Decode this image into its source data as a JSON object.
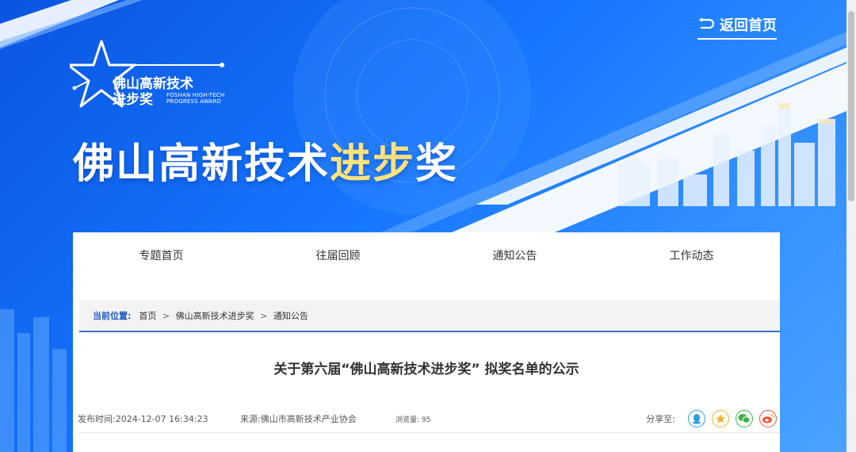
{
  "header": {
    "back_home": "返回首页",
    "logo_cn_line1": "佛山高新技术",
    "logo_cn_line2": "进步奖",
    "logo_en_line1": "FOSHAN HIGH-TECH",
    "logo_en_line2": "PROGRESS AWARD",
    "headline_white": "佛山高新技术",
    "headline_gold": "进步",
    "headline_white2": "奖"
  },
  "nav": {
    "items": [
      "专题首页",
      "往届回顾",
      "通知公告",
      "工作动态"
    ]
  },
  "breadcrumb": {
    "label": "当前位置:",
    "items": [
      "首页",
      "佛山高新技术进步奖",
      "通知公告"
    ],
    "separator": ">"
  },
  "article": {
    "title": "关于第六届“佛山高新技术进步奖” 拟奖名单的公示",
    "published": "发布时间:2024-12-07 16:34:23",
    "source": "来源:佛山市高新技术产业协会",
    "views": "浏览量: 95",
    "share_label": "分享至:"
  },
  "colors": {
    "banner_blue": "#1677ff",
    "accent_gold": "#ffe27a",
    "crumb_label": "#1f58c8",
    "qq": "#2a9be8",
    "favorite": "#f0b22a",
    "wechat": "#3fb24a",
    "weibo": "#e8563a"
  },
  "icons": [
    "back-arrow-icon",
    "qq-icon",
    "favorite-star-icon",
    "wechat-icon",
    "weibo-icon"
  ]
}
